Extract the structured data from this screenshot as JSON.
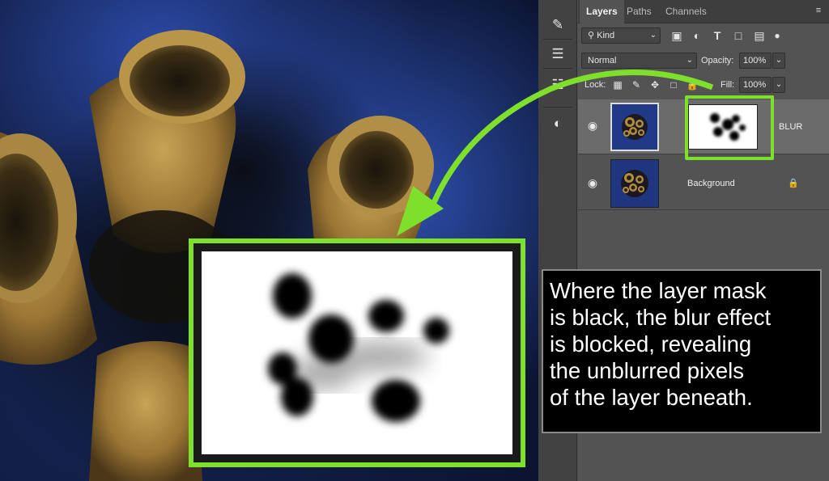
{
  "tool_strip": {
    "icons": [
      "brush-settings-icon",
      "sliders-icon",
      "layer-properties-icon",
      "adjustments-icon"
    ]
  },
  "layers_panel": {
    "tabs": [
      {
        "label": "Layers",
        "active": true
      },
      {
        "label": "Paths",
        "active": false
      },
      {
        "label": "Channels",
        "active": false
      }
    ],
    "filter": {
      "kind_label": "Kind"
    },
    "filter_icons": [
      "image-filter-icon",
      "adjustment-filter-icon",
      "type-filter-icon",
      "shape-filter-icon",
      "smart-object-filter-icon",
      "toggle-filter-icon"
    ],
    "blend_mode": "Normal",
    "opacity_label": "Opacity:",
    "opacity_value": "100%",
    "lock_label": "Lock:",
    "fill_label": "Fill:",
    "fill_value": "100%",
    "layers": [
      {
        "name": "BLUR",
        "selected": true,
        "has_mask": true,
        "visible": true
      },
      {
        "name": "Background",
        "selected": false,
        "locked": true,
        "visible": true
      }
    ]
  },
  "callout": {
    "lines": [
      "Where the layer mask",
      "is black, the blur effect",
      "is blocked, revealing",
      "the unblurred pixels",
      "of the layer beneath."
    ]
  },
  "colors": {
    "highlight_green": "#7ee02b",
    "panel_bg": "#535353",
    "selected_row": "#6b6b6b"
  }
}
